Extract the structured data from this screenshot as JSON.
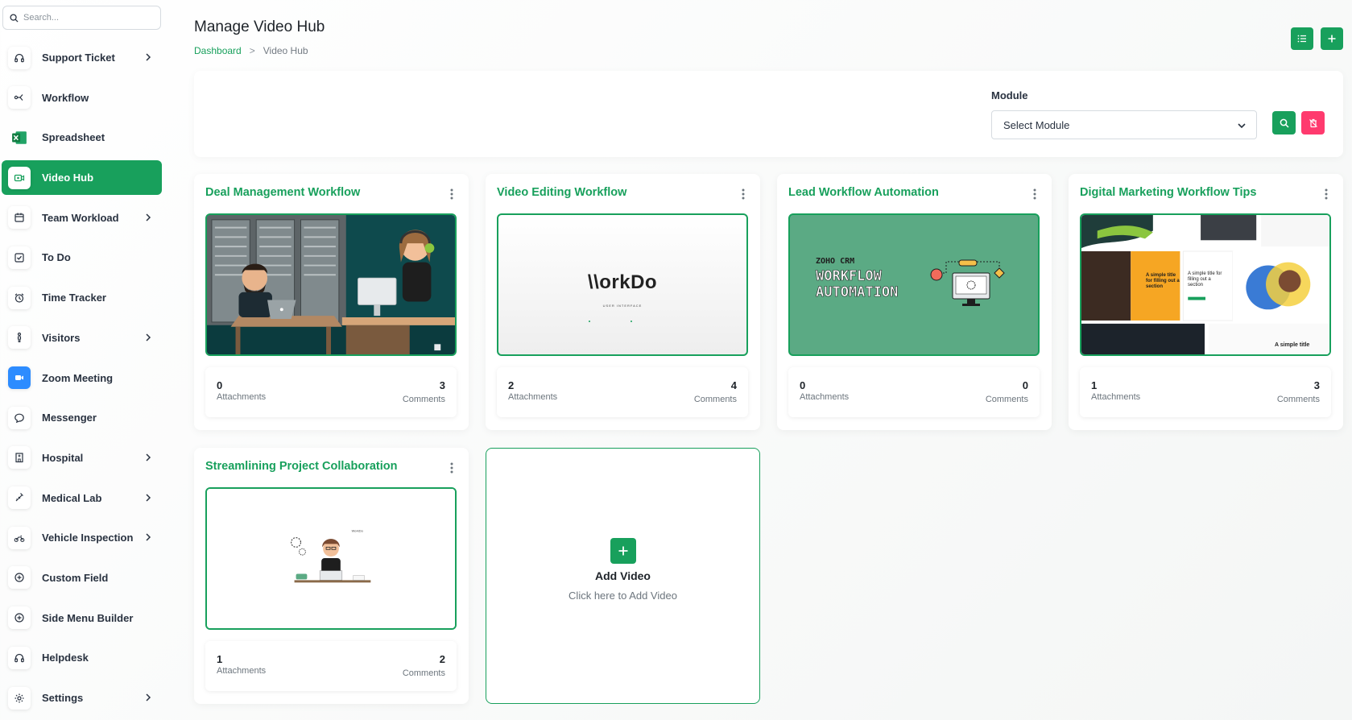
{
  "sidebar": {
    "search_placeholder": "Search...",
    "items": [
      {
        "label": "Support Ticket",
        "icon": "headset-icon",
        "chevron": true
      },
      {
        "label": "Workflow",
        "icon": "workflow-icon",
        "chevron": false
      },
      {
        "label": "Spreadsheet",
        "icon": "excel-icon",
        "chevron": false
      },
      {
        "label": "Video Hub",
        "icon": "video-icon",
        "chevron": false,
        "active": true
      },
      {
        "label": "Team Workload",
        "icon": "calendar-icon",
        "chevron": true
      },
      {
        "label": "To Do",
        "icon": "checkbox-icon",
        "chevron": false
      },
      {
        "label": "Time Tracker",
        "icon": "alarm-icon",
        "chevron": false
      },
      {
        "label": "Visitors",
        "icon": "person-icon",
        "chevron": true
      },
      {
        "label": "Zoom Meeting",
        "icon": "zoom-icon",
        "chevron": false
      },
      {
        "label": "Messenger",
        "icon": "chat-icon",
        "chevron": false
      },
      {
        "label": "Hospital",
        "icon": "hospital-icon",
        "chevron": true
      },
      {
        "label": "Medical Lab",
        "icon": "syringe-icon",
        "chevron": true
      },
      {
        "label": "Vehicle Inspection",
        "icon": "motorbike-icon",
        "chevron": true
      },
      {
        "label": "Custom Field",
        "icon": "plus-circle-icon",
        "chevron": false
      },
      {
        "label": "Side Menu Builder",
        "icon": "plus-circle-icon",
        "chevron": false
      },
      {
        "label": "Helpdesk",
        "icon": "headset-icon",
        "chevron": false
      },
      {
        "label": "Settings",
        "icon": "gear-icon",
        "chevron": true
      }
    ]
  },
  "header": {
    "title": "Manage Video Hub",
    "breadcrumb": {
      "home": "Dashboard",
      "separator": ">",
      "current": "Video Hub"
    }
  },
  "filter": {
    "label": "Module",
    "select_value": "Select Module"
  },
  "cards": [
    {
      "title": "Deal Management Workflow",
      "attachments": "0",
      "attachments_label": "Attachments",
      "comments": "3",
      "comments_label": "Comments"
    },
    {
      "title": "Video Editing Workflow",
      "attachments": "2",
      "attachments_label": "Attachments",
      "comments": "4",
      "comments_label": "Comments",
      "thumb_logo": "\\\\orkDo",
      "thumb_sub": "USER INTERFACE"
    },
    {
      "title": "Lead Workflow Automation",
      "attachments": "0",
      "attachments_label": "Attachments",
      "comments": "0",
      "comments_label": "Comments",
      "thumb_line1": "ZOHO CRM",
      "thumb_line2": "WORKFLOW",
      "thumb_line3": "AUTOMATION"
    },
    {
      "title": "Digital Marketing Workflow Tips",
      "attachments": "1",
      "attachments_label": "Attachments",
      "comments": "3",
      "comments_label": "Comments",
      "thumb_text1": "A simple title for filling out a section",
      "thumb_text2": "A simple title"
    },
    {
      "title": "Streamlining Project Collaboration",
      "attachments": "1",
      "attachments_label": "Attachments",
      "comments": "2",
      "comments_label": "Comments"
    }
  ],
  "add_card": {
    "title": "Add Video",
    "subtitle": "Click here to Add Video"
  },
  "colors": {
    "primary": "#18a05c",
    "danger": "#ff3a6e",
    "text": "#293240"
  }
}
